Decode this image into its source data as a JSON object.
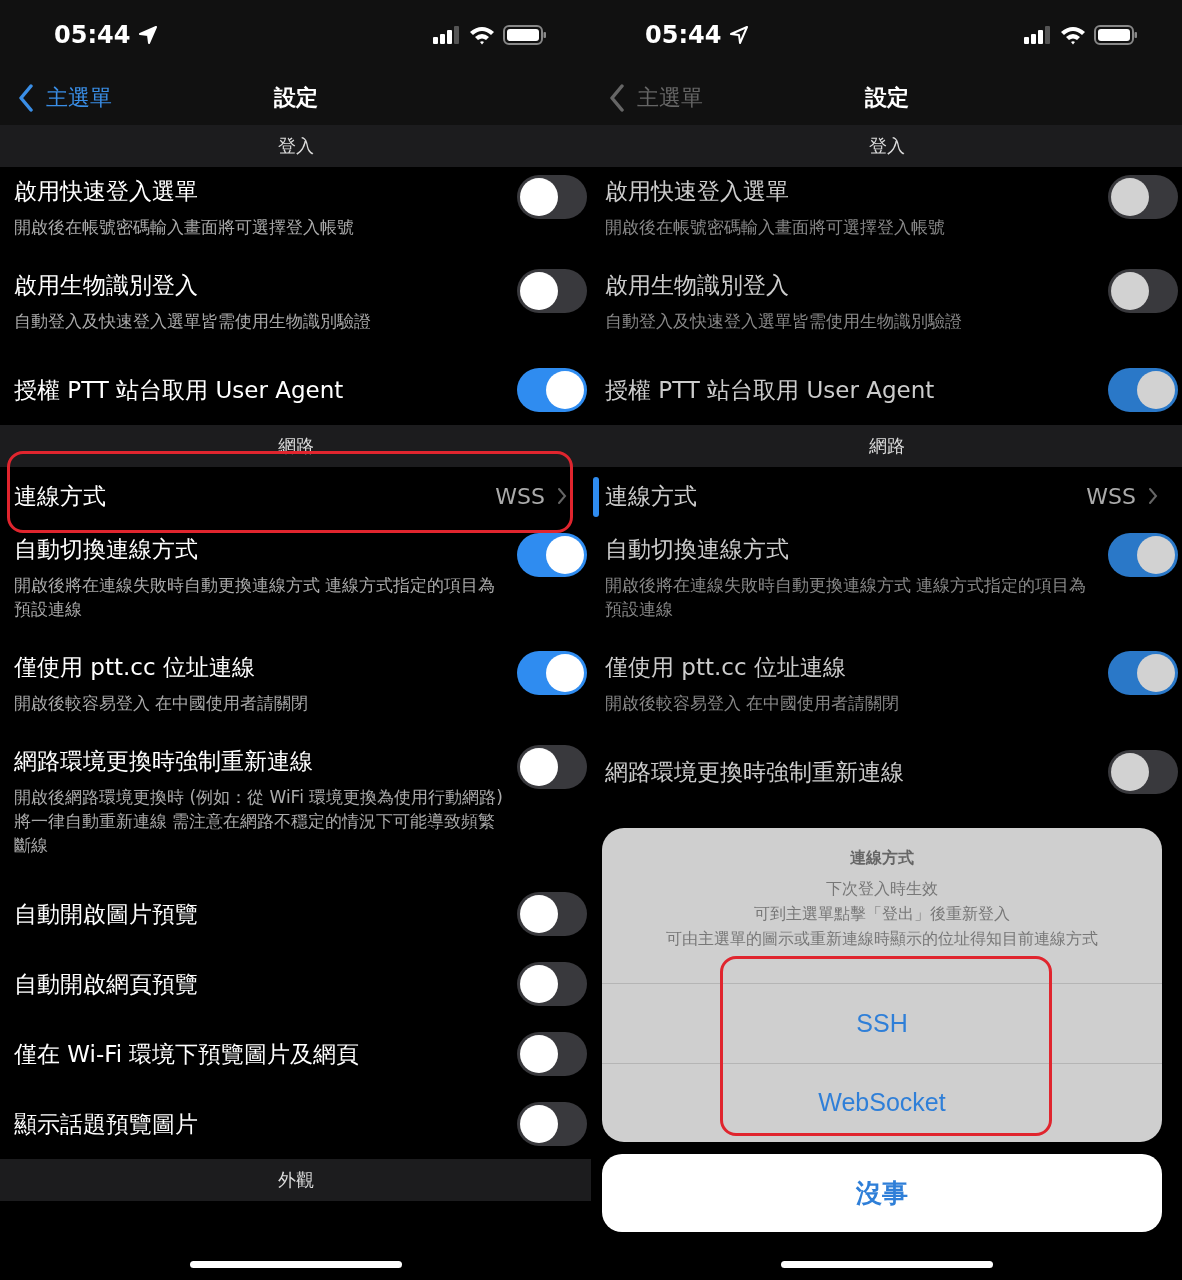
{
  "screens": [
    {
      "dimmed": false,
      "status_bar": {
        "time": "05:44"
      },
      "nav": {
        "back": "主選單",
        "title": "設定"
      },
      "sections": [
        {
          "header": "登入",
          "rows": [
            {
              "kind": "toggle",
              "title": "啟用快速登入選單",
              "subtitle": "開啟後在帳號密碼輸入畫面將可選擇登入帳號",
              "on": false
            },
            {
              "kind": "toggle",
              "title": "啟用生物識別登入",
              "subtitle": "自動登入及快速登入選單皆需使用生物識別驗證",
              "on": false
            },
            {
              "kind": "toggle",
              "title": "授權 PTT 站台取用 User Agent",
              "on": true
            }
          ]
        },
        {
          "header": "網路",
          "rows": [
            {
              "kind": "value",
              "title": "連線方式",
              "value": "WSS",
              "selected": false,
              "annotated": true
            },
            {
              "kind": "toggle",
              "title": "自動切換連線方式",
              "subtitle": "開啟後將在連線失敗時自動更換連線方式 連線方式指定的項目為預設連線",
              "on": true
            },
            {
              "kind": "toggle",
              "title": "僅使用 ptt.cc 位址連線",
              "subtitle": "開啟後較容易登入 在中國使用者請關閉",
              "on": true
            },
            {
              "kind": "toggle",
              "title": "網路環境更換時強制重新連線",
              "subtitle": "開啟後網路環境更換時 (例如：從 WiFi 環境更換為使用行動網路) 將一律自動重新連線 需注意在網路不穩定的情況下可能導致頻繁斷線",
              "on": false
            },
            {
              "kind": "toggle",
              "title": "自動開啟圖片預覽",
              "on": false
            },
            {
              "kind": "toggle",
              "title": "自動開啟網頁預覽",
              "on": false
            },
            {
              "kind": "toggle",
              "title": "僅在 Wi-Fi 環境下預覽圖片及網頁",
              "on": false
            },
            {
              "kind": "toggle",
              "title": "顯示話題預覽圖片",
              "on": false
            }
          ]
        },
        {
          "header": "外觀"
        }
      ]
    },
    {
      "dimmed": true,
      "status_bar": {
        "time": "05:44"
      },
      "nav": {
        "back": "主選單",
        "title": "設定"
      },
      "sections": [
        {
          "header": "登入",
          "rows": [
            {
              "kind": "toggle",
              "title": "啟用快速登入選單",
              "subtitle": "開啟後在帳號密碼輸入畫面將可選擇登入帳號",
              "on": false
            },
            {
              "kind": "toggle",
              "title": "啟用生物識別登入",
              "subtitle": "自動登入及快速登入選單皆需使用生物識別驗證",
              "on": false
            },
            {
              "kind": "toggle",
              "title": "授權 PTT 站台取用 User Agent",
              "on": true
            }
          ]
        },
        {
          "header": "網路",
          "rows": [
            {
              "kind": "value",
              "title": "連線方式",
              "value": "WSS",
              "selected": true,
              "annotated": false
            },
            {
              "kind": "toggle",
              "title": "自動切換連線方式",
              "subtitle": "開啟後將在連線失敗時自動更換連線方式 連線方式指定的項目為預設連線",
              "on": true
            },
            {
              "kind": "toggle",
              "title": "僅使用 ptt.cc 位址連線",
              "subtitle": "開啟後較容易登入 在中國使用者請關閉",
              "on": true
            },
            {
              "kind": "toggle",
              "title": "網路環境更換時強制重新連線",
              "on": false
            }
          ]
        }
      ],
      "action_sheet": {
        "title": "連線方式",
        "message": [
          "下次登入時生效",
          "可到主選單點擊「登出」後重新登入",
          "可由主選單的圖示或重新連線時顯示的位址得知目前連線方式"
        ],
        "options": [
          "SSH",
          "WebSocket"
        ],
        "annotated": true,
        "cancel": "沒事"
      }
    }
  ]
}
